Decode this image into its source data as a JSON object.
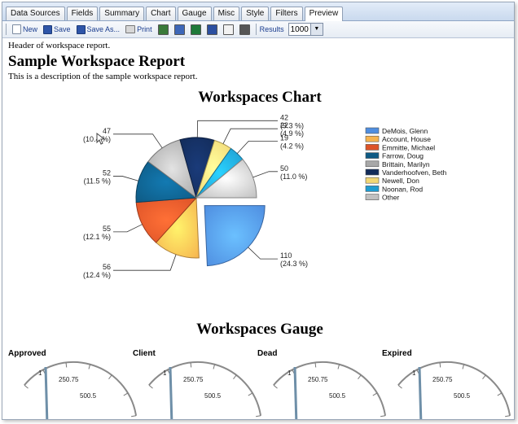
{
  "tabs": [
    "Data Sources",
    "Fields",
    "Summary",
    "Chart",
    "Gauge",
    "Misc",
    "Style",
    "Filters",
    "Preview"
  ],
  "active_tab": "Preview",
  "toolbar": {
    "new_label": "New",
    "save_label": "Save",
    "save_as_label": "Save As...",
    "print_label": "Print",
    "results_label": "Results",
    "results_value": "1000"
  },
  "report": {
    "header": "Header of workspace report.",
    "title": "Sample Workspace Report",
    "description": "This is a description of the sample workspace report."
  },
  "chart_data": {
    "type": "pie",
    "title": "Workspaces Chart",
    "slices": [
      {
        "label": "DeMois, Glenn",
        "value": 110,
        "pct": "(24.3 %)",
        "color": "#4f8ee0"
      },
      {
        "label": "Account, House",
        "value": 56,
        "pct": "(12.4 %)",
        "color": "#f6b44f"
      },
      {
        "label": "Emmitte, Michael",
        "value": 55,
        "pct": "(12.1 %)",
        "color": "#dd5328"
      },
      {
        "label": "Farrow, Doug",
        "value": 52,
        "pct": "(11.5 %)",
        "color": "#0e5a84"
      },
      {
        "label": "Brittain, Marilyn",
        "value": 47,
        "pct": "(10.4 %)",
        "color": "#a8a8a8"
      },
      {
        "label": "Vanderhoofven, Beth",
        "value": 42,
        "pct": "(9.3 %)",
        "color": "#132c5a"
      },
      {
        "label": "Newell, Don",
        "value": 22,
        "pct": "(4.9 %)",
        "color": "#f2d775"
      },
      {
        "label": "Noonan, Rod",
        "value": 19,
        "pct": "(4.2 %)",
        "color": "#1f9cd0"
      },
      {
        "label": "Other",
        "value": 50,
        "pct": "(11.0 %)",
        "color": "#c0c0c0"
      }
    ],
    "legend_position": "right"
  },
  "gauge_section": {
    "title": "Workspaces Gauge",
    "gauges": [
      {
        "label": "Approved",
        "tick1": "1",
        "tick2": "250.75",
        "tick3": "500.5"
      },
      {
        "label": "Client",
        "tick1": "1",
        "tick2": "250.75",
        "tick3": "500.5"
      },
      {
        "label": "Dead",
        "tick1": "1",
        "tick2": "250.75",
        "tick3": "500.5"
      },
      {
        "label": "Expired",
        "tick1": "1",
        "tick2": "250.75",
        "tick3": "500.5"
      }
    ]
  }
}
